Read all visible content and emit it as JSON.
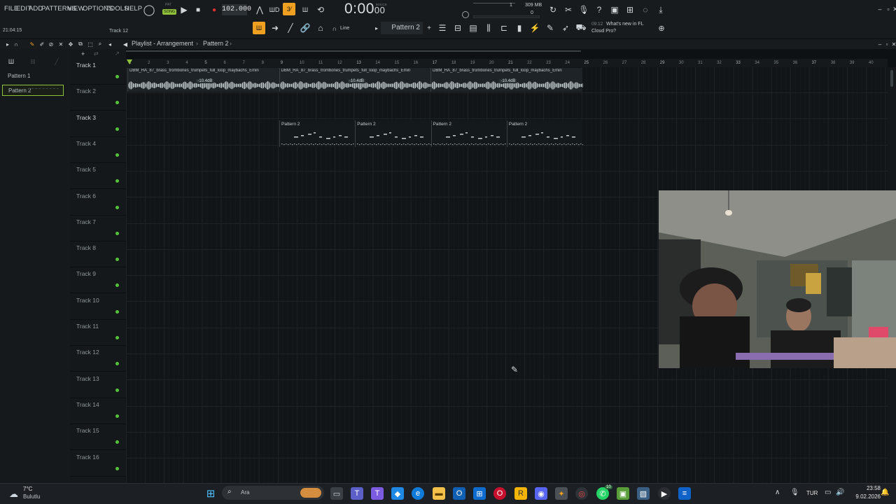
{
  "menu": [
    "FILE",
    "EDIT",
    "ADD",
    "PATTERNS",
    "VIEW",
    "OPTIONS",
    "TOOLS",
    "HELP"
  ],
  "transport": {
    "pat_label": "PAT",
    "song_label": "SONG",
    "tempo": "102.000",
    "time_main": "0:00",
    "time_sub": "00",
    "time_unit": "M:S:CS",
    "pattern_display": "Pattern 2",
    "snap_mode": "Line"
  },
  "meters": {
    "cpu_count": "1",
    "memory": "309 MB",
    "voices": "0"
  },
  "hint": {
    "clock": "21:04:15",
    "track": "Track 12"
  },
  "news": {
    "time": "09:12",
    "line1": "What's new in FL",
    "line2": "Cloud Pro?"
  },
  "playlist": {
    "title": "Playlist - Arrangement",
    "pattern_crumb": "Pattern 2",
    "patterns": [
      "Pattern 1",
      "Pattern 2"
    ]
  },
  "ruler": [
    "1",
    "2",
    "3",
    "4",
    "5",
    "6",
    "7",
    "8",
    "9",
    "10",
    "11",
    "12",
    "13",
    "14",
    "15",
    "16",
    "17",
    "18",
    "19",
    "20",
    "21",
    "22",
    "23",
    "24",
    "25",
    "26",
    "27",
    "28",
    "29",
    "30",
    "31",
    "32",
    "33",
    "34",
    "35",
    "36",
    "37",
    "38",
    "39",
    "40"
  ],
  "tracks": [
    "Track 1",
    "Track 2",
    "Track 3",
    "Track 4",
    "Track 5",
    "Track 6",
    "Track 7",
    "Track 8",
    "Track 9",
    "Track 10",
    "Track 11",
    "Track 12",
    "Track 13",
    "Track 14",
    "Track 15",
    "Track 16"
  ],
  "audio_clips": [
    {
      "name": "DBM_HA_87_brass_trombones_trumpets_full_loop_maybachs_Emin",
      "db": "-10.4dB"
    },
    {
      "name": "DBM_HA_87_brass_trombones_trumpets_full_loop_maybachs_Emin",
      "db": "-10.4dB"
    },
    {
      "name": "DBM_HA_87_brass_trombones_trumpets_full_loop_maybachs_Emin",
      "db": "-10.4dB"
    }
  ],
  "pattern_clips": [
    "Pattern 2",
    "Pattern 2",
    "Pattern 2",
    "Pattern 2"
  ],
  "taskbar": {
    "weather_temp": "7°C",
    "weather_desc": "Bulutlu",
    "search_placeholder": "Ara",
    "language": "TUR",
    "clock_time": "23:58",
    "clock_date": "9.02.2026",
    "badge": "10"
  },
  "colors": {
    "accent_orange": "#f0a020",
    "led_green": "#54c23a",
    "selection_green": "#8fc13b"
  }
}
